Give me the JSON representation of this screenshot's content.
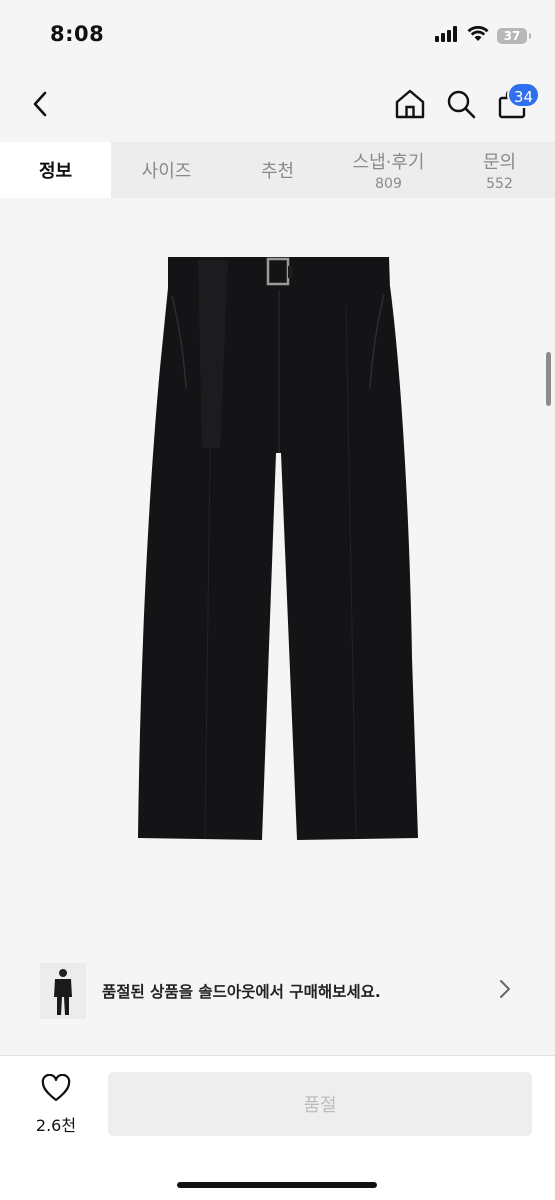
{
  "status_bar": {
    "time": "8:08",
    "battery": "37"
  },
  "nav": {
    "cart_count": "34"
  },
  "tabs": [
    {
      "label": "정보",
      "count": ""
    },
    {
      "label": "사이즈",
      "count": ""
    },
    {
      "label": "추천",
      "count": ""
    },
    {
      "label": "스냅·후기",
      "count": "809"
    },
    {
      "label": "문의",
      "count": "552"
    }
  ],
  "banner": {
    "text": "품절된 상품을 솔드아웃에서 구매해보세요."
  },
  "bottom": {
    "like_count": "2.6천",
    "soldout_label": "품절"
  },
  "colors": {
    "accent": "#2f6ff0",
    "pants": "#141416"
  }
}
